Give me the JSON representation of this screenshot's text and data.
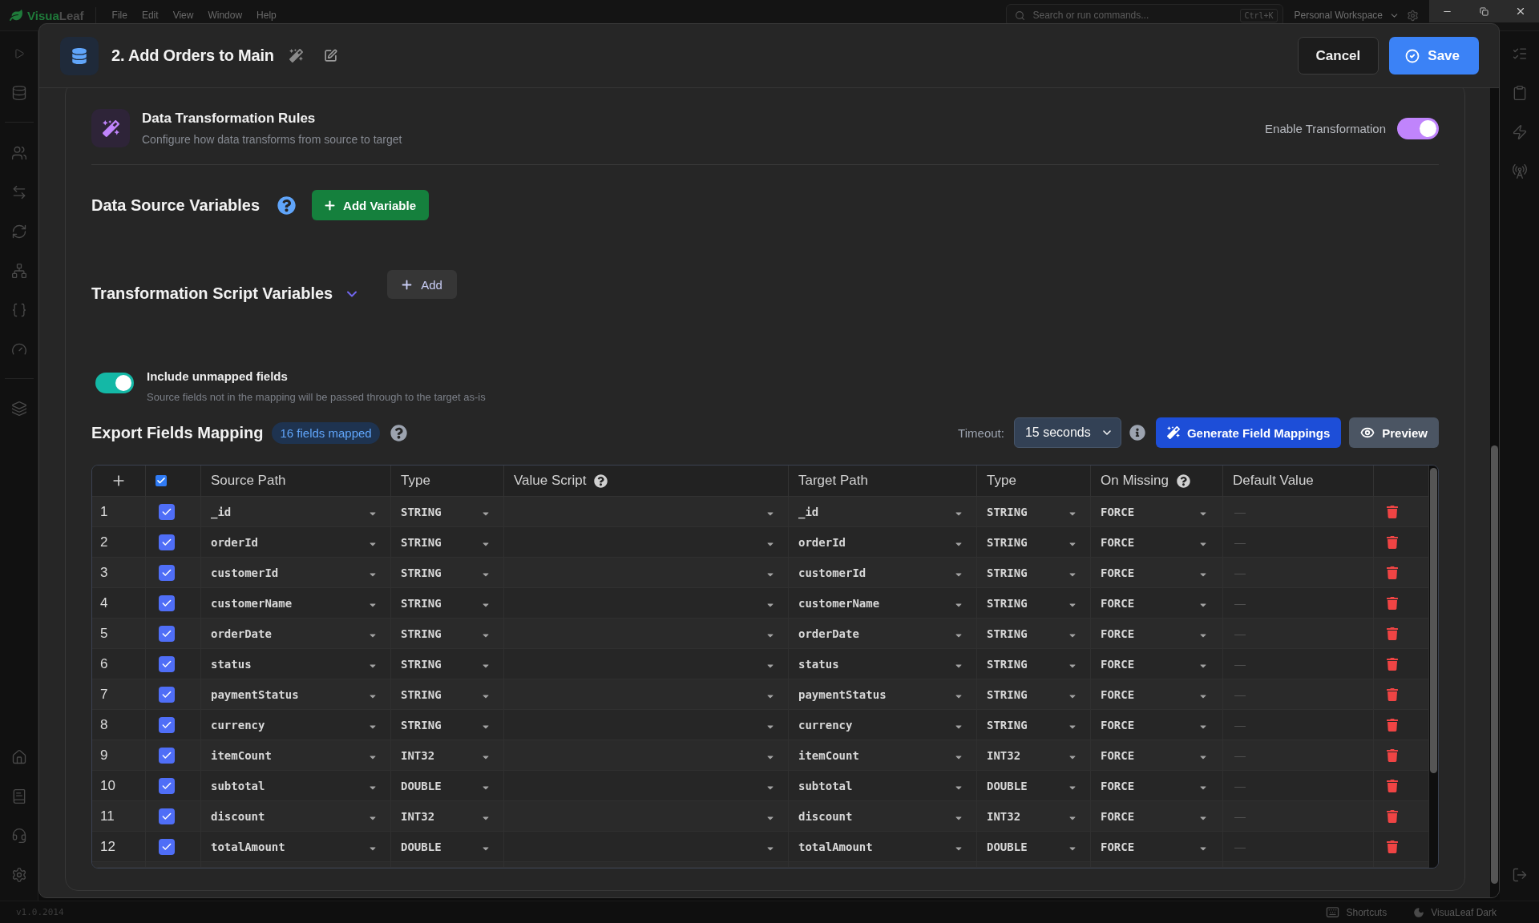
{
  "title_bar": {
    "app_name": {
      "first": "Visua",
      "rest": "Leaf"
    },
    "menu": [
      "File",
      "Edit",
      "View",
      "Window",
      "Help"
    ],
    "search": {
      "placeholder": "Search or run commands...",
      "shortcut": "Ctrl+K"
    },
    "workspace": "Personal Workspace"
  },
  "dialog": {
    "title": "2. Add Orders to Main",
    "cancel_button": "Cancel",
    "save_button": "Save",
    "transformation": {
      "title": "Data Transformation Rules",
      "subtitle": "Configure how data transforms from source to target",
      "toggle_label": "Enable Transformation",
      "on": true
    },
    "data_source_variables": {
      "title": "Data Source Variables",
      "add_button": "Add Variable"
    },
    "script_variables": {
      "title": "Transformation Script Variables",
      "expanded": true,
      "add_button": "Add"
    },
    "include_unmapped": {
      "label": "Include unmapped fields",
      "description": "Source fields not in the mapping will be passed through to the target as-is",
      "on": true
    },
    "mapping": {
      "title": "Export Fields Mapping",
      "badge": "16 fields mapped",
      "timeout_label": "Timeout:",
      "timeout": "15 seconds",
      "generate_button": "Generate Field Mappings",
      "preview_button": "Preview",
      "columns": [
        {
          "kind": "add"
        },
        {
          "kind": "select",
          "checked": true
        },
        {
          "kind": "label",
          "label": "Source Path",
          "help": false
        },
        {
          "kind": "label",
          "label": "Type",
          "help": false
        },
        {
          "kind": "label",
          "label": "Value Script",
          "help": true
        },
        {
          "kind": "label",
          "label": "Target Path",
          "help": false
        },
        {
          "kind": "label",
          "label": "Type",
          "help": false
        },
        {
          "kind": "label",
          "label": "On Missing",
          "help": true
        },
        {
          "kind": "label",
          "label": "Default Value",
          "help": false
        }
      ],
      "rows": [
        {
          "number": "1",
          "checked": true,
          "source_path": "_id",
          "source_type": "STRING",
          "target_path": "_id",
          "target_type": "STRING",
          "on_missing": "FORCE",
          "default_value": {
            "placeholder": "—"
          }
        },
        {
          "number": "2",
          "checked": true,
          "source_path": "orderId",
          "source_type": "STRING",
          "target_path": "orderId",
          "target_type": "STRING",
          "on_missing": "FORCE",
          "default_value": {
            "placeholder": "—"
          }
        },
        {
          "number": "3",
          "checked": true,
          "source_path": "customerId",
          "source_type": "STRING",
          "target_path": "customerId",
          "target_type": "STRING",
          "on_missing": "FORCE",
          "default_value": {
            "placeholder": "—"
          }
        },
        {
          "number": "4",
          "checked": true,
          "source_path": "customerName",
          "source_type": "STRING",
          "target_path": "customerName",
          "target_type": "STRING",
          "on_missing": "FORCE",
          "default_value": {
            "placeholder": "—"
          }
        },
        {
          "number": "5",
          "checked": true,
          "source_path": "orderDate",
          "source_type": "STRING",
          "target_path": "orderDate",
          "target_type": "STRING",
          "on_missing": "FORCE",
          "default_value": {
            "placeholder": "—"
          }
        },
        {
          "number": "6",
          "checked": true,
          "source_path": "status",
          "source_type": "STRING",
          "target_path": "status",
          "target_type": "STRING",
          "on_missing": "FORCE",
          "default_value": {
            "placeholder": "—"
          }
        },
        {
          "number": "7",
          "checked": true,
          "source_path": "paymentStatus",
          "source_type": "STRING",
          "target_path": "paymentStatus",
          "target_type": "STRING",
          "on_missing": "FORCE",
          "default_value": {
            "placeholder": "—"
          }
        },
        {
          "number": "8",
          "checked": true,
          "source_path": "currency",
          "source_type": "STRING",
          "target_path": "currency",
          "target_type": "STRING",
          "on_missing": "FORCE",
          "default_value": {
            "placeholder": "—"
          }
        },
        {
          "number": "9",
          "checked": true,
          "source_path": "itemCount",
          "source_type": "INT32",
          "target_path": "itemCount",
          "target_type": "INT32",
          "on_missing": "FORCE",
          "default_value": {
            "placeholder": "—"
          }
        },
        {
          "number": "10",
          "checked": true,
          "source_path": "subtotal",
          "source_type": "DOUBLE",
          "target_path": "subtotal",
          "target_type": "DOUBLE",
          "on_missing": "FORCE",
          "default_value": {
            "placeholder": "—"
          }
        },
        {
          "number": "11",
          "checked": true,
          "source_path": "discount",
          "source_type": "INT32",
          "target_path": "discount",
          "target_type": "INT32",
          "on_missing": "FORCE",
          "default_value": {
            "placeholder": "—"
          }
        },
        {
          "number": "12",
          "checked": true,
          "source_path": "totalAmount",
          "source_type": "DOUBLE",
          "target_path": "totalAmount",
          "target_type": "DOUBLE",
          "on_missing": "FORCE",
          "default_value": {
            "placeholder": "—"
          }
        }
      ]
    }
  },
  "status_bar": {
    "version": "v1.0.2014",
    "shortcuts": "Shortcuts",
    "theme": "VisuaLeaf Dark"
  }
}
